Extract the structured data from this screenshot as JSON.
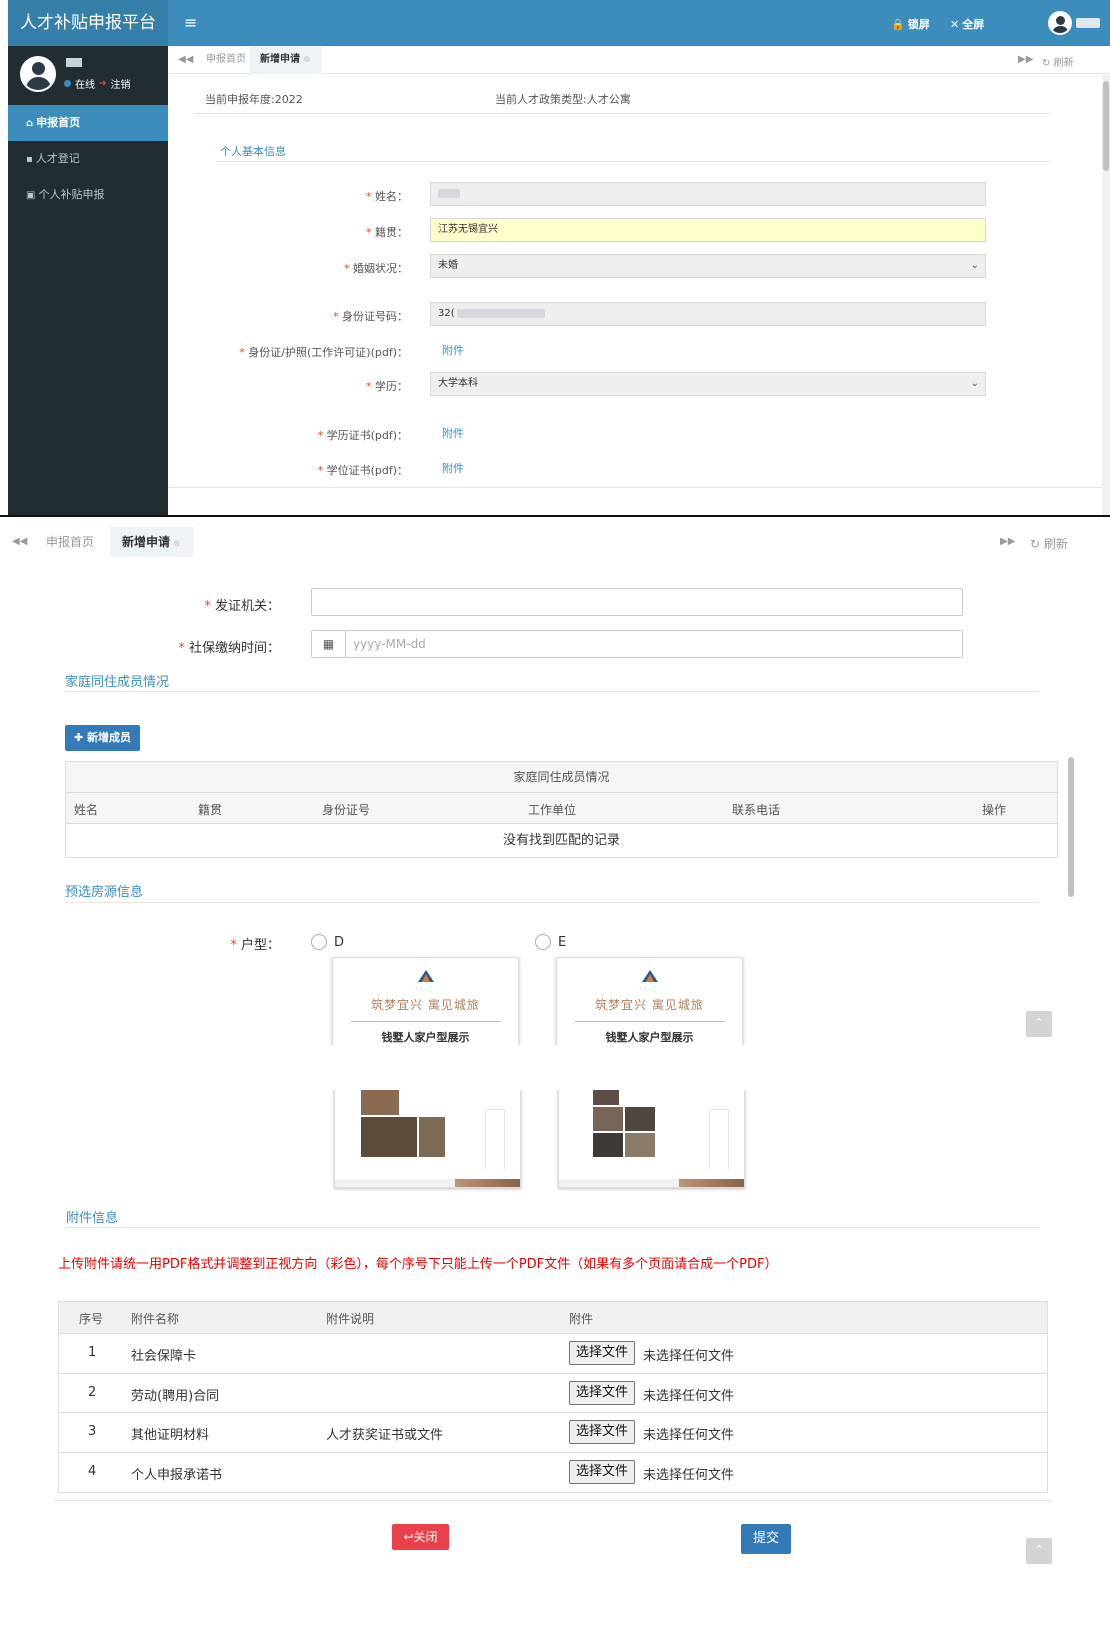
{
  "app": {
    "title": "人才补贴申报平台",
    "menu_toggle": "≡",
    "lock_label": "锁屏",
    "fullscreen_label": "全屏"
  },
  "user": {
    "status_online": "在线",
    "logout": "注销"
  },
  "sidebar": {
    "items": [
      {
        "label": "申报首页",
        "icon": "home-icon",
        "active": true
      },
      {
        "label": "人才登记",
        "icon": "book-icon",
        "active": false
      },
      {
        "label": "个人补贴申报",
        "icon": "id-card-icon",
        "active": false
      }
    ]
  },
  "tabs": {
    "home": "申报首页",
    "new": "新增申请",
    "refresh": "刷新"
  },
  "meta": {
    "year": "当前申报年度:2022",
    "policy_type": "当前人才政策类型:人才公寓"
  },
  "basic_info": {
    "section_title": "个人基本信息",
    "name_label": "姓名：",
    "native_label": "籍贯：",
    "native_value": "江苏无锡宜兴",
    "marital_label": "婚姻状况：",
    "marital_value": "未婚",
    "id_label": "身份证号码：",
    "id_value_prefix": "32(",
    "id_attach_label": "身份证/护照(工作许可证)(pdf)：",
    "attach_link": "附件",
    "education_label": "学历：",
    "education_value": "大学本科",
    "edu_cert_label": "学历证书(pdf)：",
    "degree_cert_label": "学位证书(pdf)："
  },
  "form2": {
    "issuer_label": "发证机关：",
    "issuer_value": "",
    "social_time_label": "社保缴纳时间：",
    "social_time_placeholder": "yyyy-MM-dd"
  },
  "family": {
    "section_title": "家庭同住成员情况",
    "add_button": "新增成员",
    "table_caption": "家庭同住成员情况",
    "columns": [
      "姓名",
      "籍贯",
      "身份证号",
      "工作单位",
      "联系电话",
      "操作"
    ],
    "empty_text": "没有找到匹配的记录"
  },
  "housing": {
    "section_title": "预选房源信息",
    "type_label": "户型：",
    "options": [
      {
        "label": "D",
        "title": "筑梦宜兴  寓见城旅",
        "subtitle": "钱墅人家户型展示"
      },
      {
        "label": "E",
        "title": "筑梦宜兴  寓见城旅",
        "subtitle": "钱墅人家户型展示"
      }
    ]
  },
  "attachments": {
    "section_title": "附件信息",
    "notice": "上传附件请统一用PDF格式并调整到正视方向（彩色），每个序号下只能上传一个PDF文件（如果有多个页面请合成一个PDF）",
    "columns": [
      "序号",
      "附件名称",
      "附件说明",
      "附件"
    ],
    "rows": [
      {
        "no": "1",
        "name": "社会保障卡",
        "desc": ""
      },
      {
        "no": "2",
        "name": "劳动(聘用)合同",
        "desc": ""
      },
      {
        "no": "3",
        "name": "其他证明材料",
        "desc": "人才获奖证书或文件"
      },
      {
        "no": "4",
        "name": "个人申报承诺书",
        "desc": ""
      }
    ],
    "choose_file": "选择文件",
    "no_file": "未选择任何文件"
  },
  "actions": {
    "close": "关闭",
    "submit": "提交"
  },
  "colors": {
    "primary": "#3c8dbc",
    "sidebar_bg": "#222d32",
    "danger": "#e9414a",
    "button_blue": "#337ab7",
    "highlight_input": "#ffffcc"
  }
}
